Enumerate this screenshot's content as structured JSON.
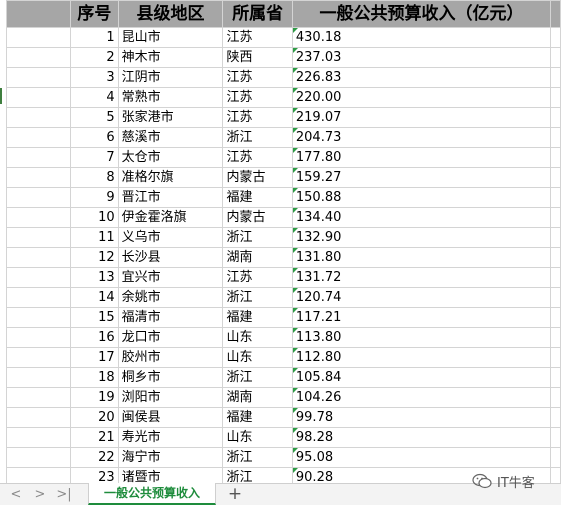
{
  "headers": [
    "序号",
    "县级地区",
    "所属省",
    "一般公共预算收入（亿元）"
  ],
  "rows": [
    {
      "no": "1",
      "name": "昆山市",
      "province": "江苏",
      "revenue": "430.18"
    },
    {
      "no": "2",
      "name": "神木市",
      "province": "陕西",
      "revenue": "237.03"
    },
    {
      "no": "3",
      "name": "江阴市",
      "province": "江苏",
      "revenue": "226.83"
    },
    {
      "no": "4",
      "name": "常熟市",
      "province": "江苏",
      "revenue": "220.00"
    },
    {
      "no": "5",
      "name": "张家港市",
      "province": "江苏",
      "revenue": "219.07"
    },
    {
      "no": "6",
      "name": "慈溪市",
      "province": "浙江",
      "revenue": "204.73"
    },
    {
      "no": "7",
      "name": "太仓市",
      "province": "江苏",
      "revenue": "177.80"
    },
    {
      "no": "8",
      "name": "准格尔旗",
      "province": "内蒙古",
      "revenue": "159.27"
    },
    {
      "no": "9",
      "name": "晋江市",
      "province": "福建",
      "revenue": "150.88"
    },
    {
      "no": "10",
      "name": "伊金霍洛旗",
      "province": "内蒙古",
      "revenue": "134.40"
    },
    {
      "no": "11",
      "name": "义乌市",
      "province": "浙江",
      "revenue": "132.90"
    },
    {
      "no": "12",
      "name": "长沙县",
      "province": "湖南",
      "revenue": "131.80"
    },
    {
      "no": "13",
      "name": "宜兴市",
      "province": "江苏",
      "revenue": "131.72"
    },
    {
      "no": "14",
      "name": "余姚市",
      "province": "浙江",
      "revenue": "120.74"
    },
    {
      "no": "15",
      "name": "福清市",
      "province": "福建",
      "revenue": "117.21"
    },
    {
      "no": "16",
      "name": "龙口市",
      "province": "山东",
      "revenue": "113.80"
    },
    {
      "no": "17",
      "name": "胶州市",
      "province": "山东",
      "revenue": "112.80"
    },
    {
      "no": "18",
      "name": "桐乡市",
      "province": "浙江",
      "revenue": "105.84"
    },
    {
      "no": "19",
      "name": "浏阳市",
      "province": "湖南",
      "revenue": "104.26"
    },
    {
      "no": "20",
      "name": "闽侯县",
      "province": "福建",
      "revenue": "99.78"
    },
    {
      "no": "21",
      "name": "寿光市",
      "province": "山东",
      "revenue": "98.28"
    },
    {
      "no": "22",
      "name": "海宁市",
      "province": "浙江",
      "revenue": "95.08"
    },
    {
      "no": "23",
      "name": "诸暨市",
      "province": "浙江",
      "revenue": "90.28"
    }
  ],
  "tabbar": {
    "nav_first": "|<",
    "nav_prev": "<",
    "nav_next": ">",
    "nav_last": ">|",
    "active_sheet": "一般公共预算收入",
    "add_sheet": "+"
  },
  "watermark": {
    "text": "IT牛客",
    "icon": "wechat-icon"
  },
  "colors": {
    "header_fill": "#a6a6a6",
    "tab_accent": "#1e8c3c",
    "comment_marker": "#2e9b46"
  }
}
